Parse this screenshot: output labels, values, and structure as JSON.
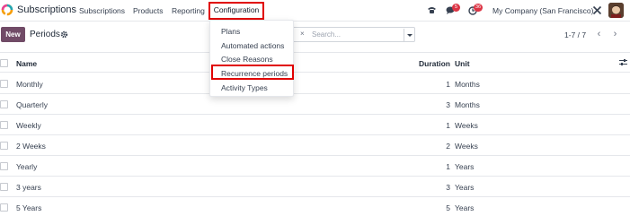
{
  "app": {
    "name": "Subscriptions"
  },
  "nav": {
    "items": [
      "Subscriptions",
      "Products",
      "Reporting"
    ],
    "configuration": "Configuration"
  },
  "systray": {
    "messages_count": "5",
    "activities_count": "36",
    "company": "My Company (San Francisco)"
  },
  "control": {
    "new_label": "New",
    "title": "Periods",
    "facet_fragment": "s",
    "search_placeholder": "Search...",
    "pager": "1-7 / 7"
  },
  "table": {
    "headers": {
      "name": "Name",
      "duration": "Duration",
      "unit": "Unit"
    },
    "rows": [
      {
        "name": "Monthly",
        "duration": "1",
        "unit": "Months"
      },
      {
        "name": "Quarterly",
        "duration": "3",
        "unit": "Months"
      },
      {
        "name": "Weekly",
        "duration": "1",
        "unit": "Weeks"
      },
      {
        "name": "2 Weeks",
        "duration": "2",
        "unit": "Weeks"
      },
      {
        "name": "Yearly",
        "duration": "1",
        "unit": "Years"
      },
      {
        "name": "3 years",
        "duration": "3",
        "unit": "Years"
      },
      {
        "name": "5 Years",
        "duration": "5",
        "unit": "Years"
      }
    ]
  },
  "dropdown": {
    "items": [
      "Plans",
      "Automated actions",
      "Close Reasons",
      "Recurrence periods",
      "Activity Types"
    ],
    "highlighted": "Recurrence periods"
  },
  "colors": {
    "brand": "#714b67",
    "annotation_red": "#e00000",
    "badge_red": "#dc3545"
  }
}
